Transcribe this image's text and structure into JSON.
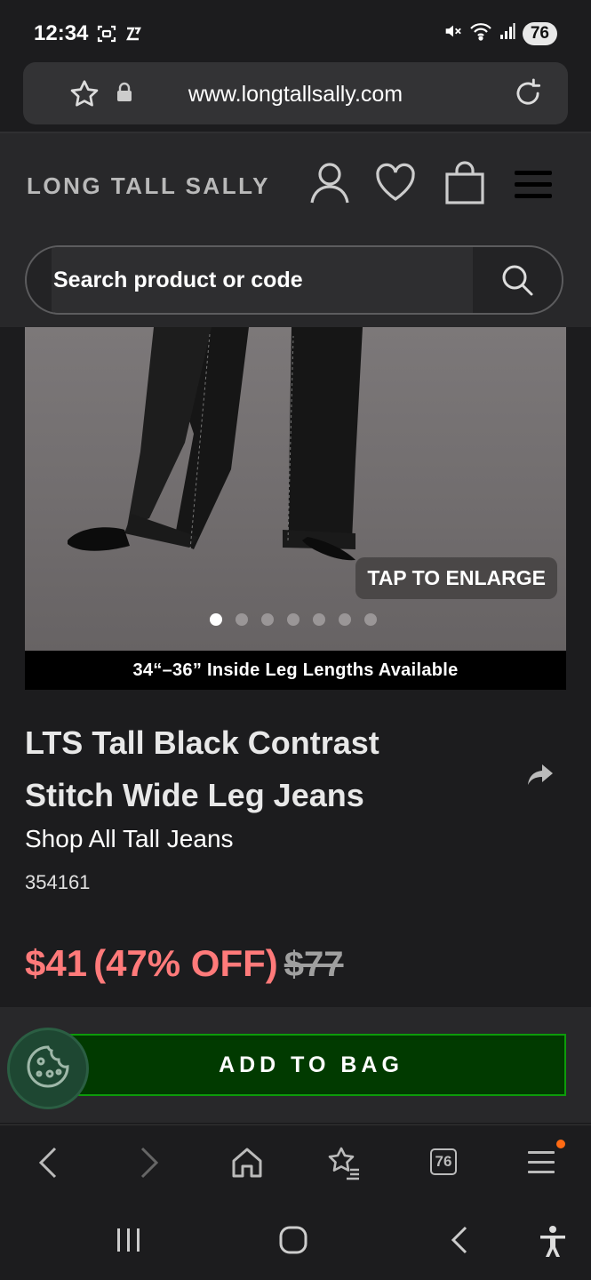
{
  "status": {
    "time": "12:34",
    "battery": "76"
  },
  "browser": {
    "url": "www.longtallsally.com",
    "tab_count": "76"
  },
  "site": {
    "logo": "LONG TALL SALLY",
    "search_placeholder": "Search product or code"
  },
  "gallery": {
    "enlarge_label": "TAP TO ENLARGE",
    "dot_count": 7,
    "active_index": 0,
    "banner": "34“–36” Inside Leg Lengths Available"
  },
  "product": {
    "title": "LTS Tall Black Contrast Stitch Wide Leg Jeans",
    "shop_link": "Shop All Tall Jeans",
    "code": "354161",
    "price_now": "$41",
    "discount": "(47% OFF)",
    "price_was": "$77",
    "add_to_bag": "ADD TO BAG"
  },
  "colors": {
    "price_sale": "#ff7a7a",
    "cta_bg": "#013a00",
    "cta_border": "#0d9b0a",
    "notification": "#ff6a13"
  }
}
